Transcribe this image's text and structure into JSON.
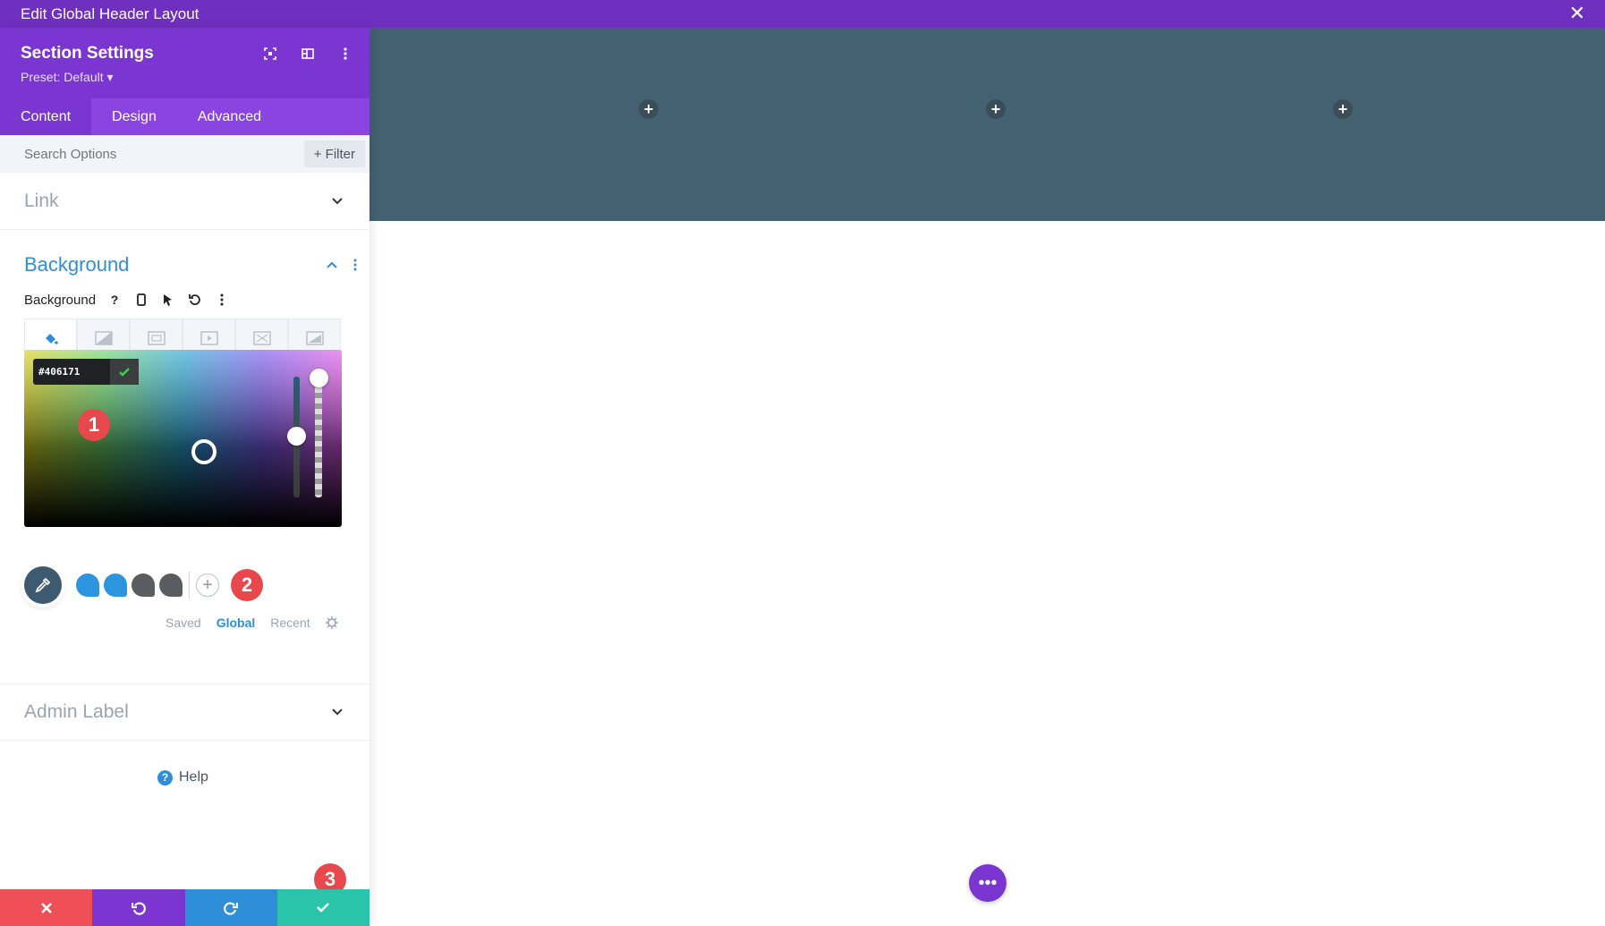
{
  "window": {
    "title": "Edit Global Header Layout"
  },
  "panel": {
    "title": "Section Settings",
    "preset": "Preset: Default ▾",
    "tabs": [
      "Content",
      "Design",
      "Advanced"
    ],
    "active_tab": "Content"
  },
  "search": {
    "placeholder": "Search Options",
    "filter_label": "+ Filter"
  },
  "sections": {
    "link": "Link",
    "background": "Background",
    "admin_label": "Admin Label"
  },
  "background_field": {
    "label": "Background",
    "help_icon": "?",
    "types": [
      "paint-bucket-icon",
      "gradient-icon",
      "image-icon",
      "video-icon",
      "pattern-icon",
      "mask-icon"
    ]
  },
  "color_picker": {
    "hex": "#406171",
    "badges": [
      "1",
      "2",
      "3"
    ]
  },
  "swatches": {
    "colors": [
      "#2d95de",
      "#2d95de",
      "#5a5d60",
      "#5a5d60"
    ],
    "tabs": [
      "Saved",
      "Global",
      "Recent"
    ],
    "active_tab": "Global"
  },
  "help": {
    "label": "Help"
  },
  "canvas": {
    "header_color": "#446171",
    "accent": "#7b36d1"
  }
}
